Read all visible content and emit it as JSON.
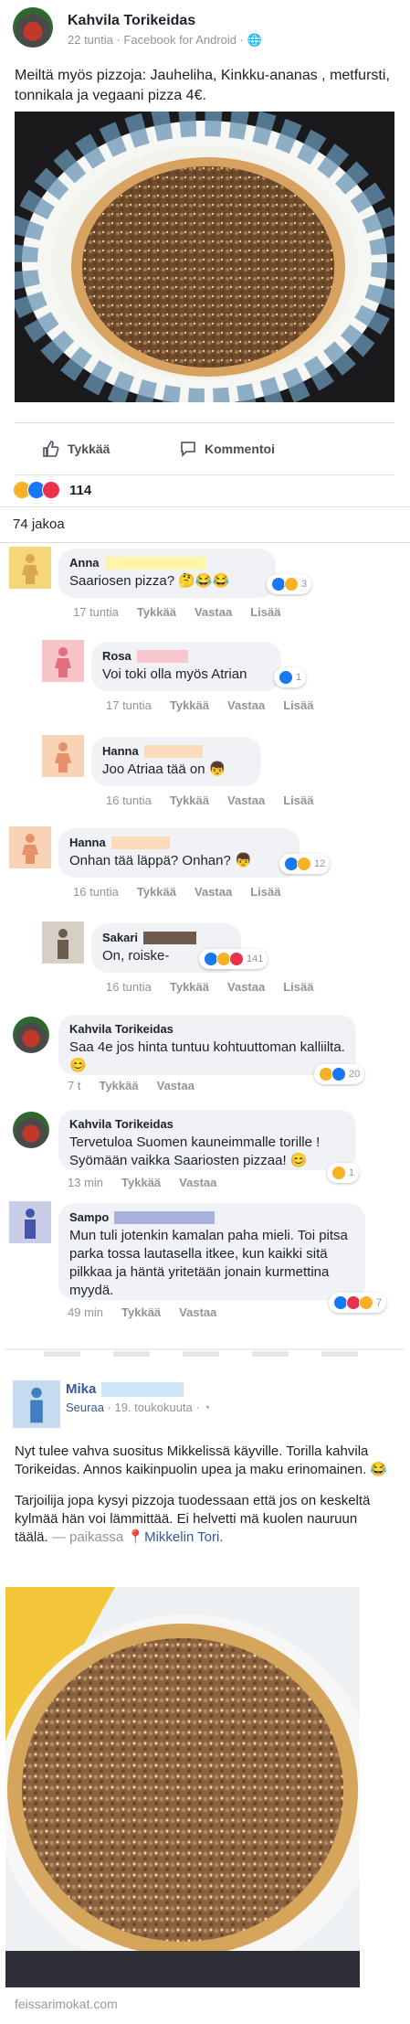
{
  "post": {
    "author": "Kahvila Torikeidas",
    "meta": "22 tuntia · Facebook for Android · ",
    "text": "Meiltä myös pizzoja: Jauheliha, Kinkku-ananas , metfursti, tonnikala ja vegaani pizza 4€.",
    "actions": {
      "like": "Tykkää",
      "comment": "Kommentoi"
    },
    "reaction_count": "114",
    "shares": "74 jakoa"
  },
  "comments": [
    {
      "name": "Anna",
      "text": "Saariosen pizza? 🤔😂😂",
      "time": "17 tuntia",
      "like": "Tykkää",
      "reply": "Vastaa",
      "more": "Lisää",
      "reactions": "3",
      "avatar_color": "#f5d77a",
      "figure_color": "#d9a84a",
      "redact_color": "#fbf5a5"
    },
    {
      "name": "Rosa",
      "text": "Voi toki olla myös Atrian",
      "time": "17 tuntia",
      "like": "Tykkää",
      "reply": "Vastaa",
      "more": "Lisää",
      "reactions": "1",
      "avatar_color": "#f7c4c8",
      "figure_color": "#e2707f",
      "redact_color": "#f9c6cf"
    },
    {
      "name": "Hanna",
      "text": "Joo Atriaa tää on 👦",
      "time": "16 tuntia",
      "like": "Tykkää",
      "reply": "Vastaa",
      "more": "Lisää",
      "reactions": "",
      "avatar_color": "#f9d3b5",
      "figure_color": "#e8906a",
      "redact_color": "#fbd9bb"
    },
    {
      "name": "Hanna",
      "text": "Onhan tää läppä? Onhan? 👦",
      "time": "16 tuntia",
      "like": "Tykkää",
      "reply": "Vastaa",
      "more": "Lisää",
      "reactions": "12",
      "avatar_color": "#f9d3b5",
      "figure_color": "#e8906a",
      "redact_color": "#fbd9bb"
    },
    {
      "name": "Sakari",
      "text": "On, roiske-",
      "time": "16 tuntia",
      "like": "Tykkää",
      "reply": "Vastaa",
      "more": "Lisää",
      "reactions": "141",
      "avatar_color": "#d6cfc6",
      "figure_color": "#6b5c4e",
      "redact_color": "#6e5b4d"
    },
    {
      "name": "Kahvila Torikeidas",
      "text": "Saa 4e jos hinta tuntuu kohtuuttoman kalliilta.😊",
      "time": "7 t",
      "like": "Tykkää",
      "reply": "Vastaa",
      "more": "",
      "reactions": "20"
    },
    {
      "name": "Kahvila Torikeidas",
      "text": "Tervetuloa Suomen kauneimmalle torille ! Syömään vaikka Saariosten pizzaa! 😊",
      "time": "13 min",
      "like": "Tykkää",
      "reply": "Vastaa",
      "more": "",
      "reactions": "1"
    },
    {
      "name": "Sampo",
      "text": "Mun tuli jotenkin kamalan paha mieli. Toi pitsa parka tossa lautasella itkee, kun kaikki sitä pilkkaa ja häntä yritetään jonain kurmettina myydä.",
      "time": "49 min",
      "like": "Tykkää",
      "reply": "Vastaa",
      "more": "",
      "reactions": "7",
      "avatar_color": "#c9cde8",
      "figure_color": "#4556a8",
      "redact_color": "#a8b1dc"
    }
  ],
  "post2": {
    "author": "Mika",
    "follow": "Seuraa",
    "meta": " · 19. toukokuuta · ",
    "para1": "Nyt tulee vahva suositus Mikkelissä käyville. Torilla kahvila Torikeidas. Annos kaikinpuolin upea ja maku erinomainen. 😂",
    "para2_text": "Tarjoilija jopa kysyi pizzoja tuodessaan että jos on keskeltä kylmää hän voi lämmittää. Ei helvetti mä kuolen nauruun täälä. ",
    "para2_meta": "— paikassa ",
    "location": "Mikkelin Tori.",
    "avatar_color": "#c7dbf0",
    "figure_color": "#3e7fc1",
    "redact_color": "#cfe6f8"
  },
  "watermark": "feissarimokat.com"
}
